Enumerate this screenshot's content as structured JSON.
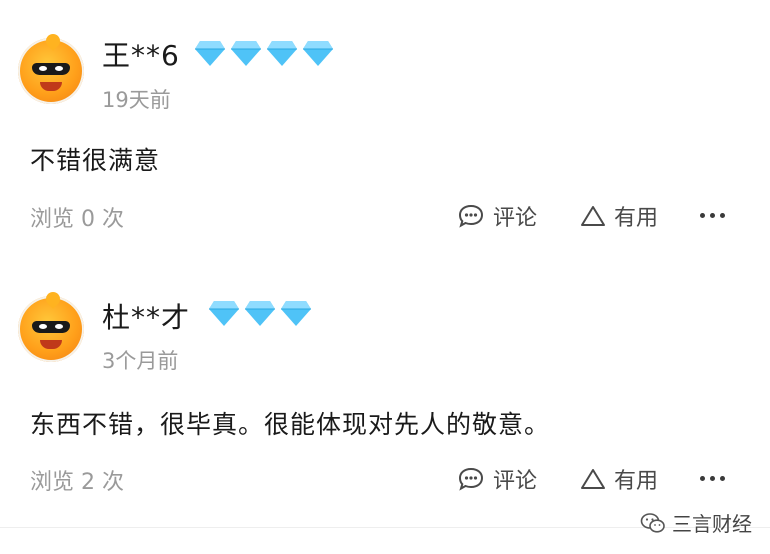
{
  "reviews": [
    {
      "username": "王**6",
      "diamond_count": 4,
      "time": "19天前",
      "content": "不错很满意",
      "views": "浏览 0 次",
      "comment_label": "评论",
      "useful_label": "有用"
    },
    {
      "username": "杜**才",
      "diamond_count": 3,
      "time": "3个月前",
      "content": "东西不错，很毕真。很能体现对先人的敬意。",
      "views": "浏览 2 次",
      "comment_label": "评论",
      "useful_label": "有用"
    }
  ],
  "watermark": {
    "text": "三言财经"
  },
  "colors": {
    "diamond": "#4fc3f7",
    "muted": "#9a9a9a",
    "avatar": "#ffa41f"
  },
  "icons": [
    "chat-bubble-icon",
    "triangle-icon",
    "more-dots-icon",
    "diamond-icon",
    "wechat-icon"
  ]
}
